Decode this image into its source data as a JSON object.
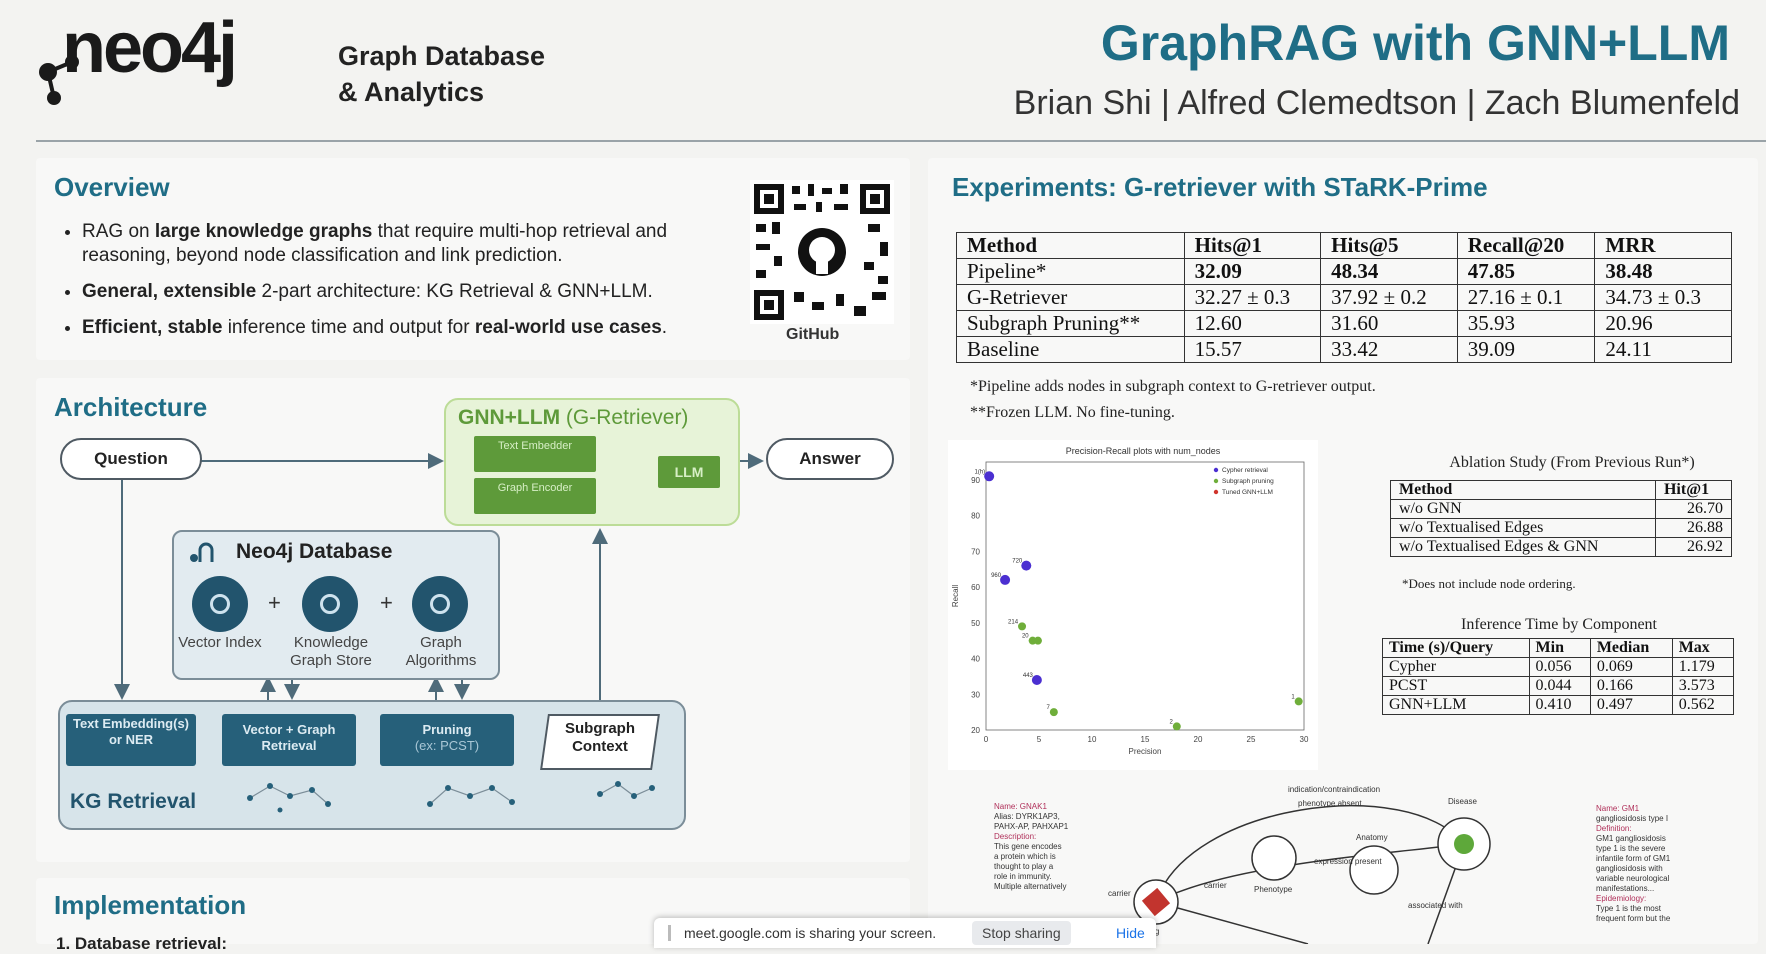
{
  "header": {
    "logo_text": "neo4j",
    "logo_subtitle_line1": "Graph Database",
    "logo_subtitle_line2": "& Analytics",
    "title": "GraphRAG with GNN+LLM",
    "authors": "Brian Shi | Alfred Clemedtson | Zach Blumenfeld"
  },
  "overview": {
    "title": "Overview",
    "bullets": [
      {
        "b1": "RAG on ",
        "b2": "large knowledge graphs",
        "b3": " that require multi-hop retrieval and reasoning, beyond node classification and link prediction."
      },
      {
        "b1": "",
        "b2": "General, extensible",
        "b3": " 2-part architecture: KG Retrieval & GNN+LLM."
      },
      {
        "b1": "",
        "b2": "Efficient, stable",
        "b3": " inference time and output for ",
        "b4": "real-world use cases",
        "b5": "."
      }
    ],
    "qr_label": "GitHub"
  },
  "architecture": {
    "title": "Architecture",
    "gnn_title": "GNN+LLM",
    "gnn_subtitle": "(G-Retriever)",
    "text_embedder": "Text Embedder",
    "graph_encoder": "Graph Encoder",
    "llm": "LLM",
    "question": "Question",
    "answer": "Answer",
    "db_title": "Neo4j Database",
    "vector_index": "Vector Index",
    "kg_store": "Knowledge Graph Store",
    "graph_algorithms": "Graph Algorithms",
    "plus": "+",
    "text_embedding": "Text Embedding(s) or NER",
    "vector_graph_retrieval": "Vector + Graph Retrieval",
    "pruning": "Pruning",
    "pruning_sub": "(ex: PCST)",
    "subgraph_context": "Subgraph Context",
    "kg_retrieval": "KG Retrieval"
  },
  "implementation": {
    "title": "Implementation",
    "item1": "1.  Database retrieval:"
  },
  "experiments": {
    "title": "Experiments: G-retriever with STaRK-Prime",
    "headers": [
      "Method",
      "Hits@1",
      "Hits@5",
      "Recall@20",
      "MRR"
    ],
    "rows": [
      [
        "Pipeline*",
        "32.09",
        "48.34",
        "47.85",
        "38.48"
      ],
      [
        "G-Retriever",
        "32.27 ± 0.3",
        "37.92 ± 0.2",
        "27.16 ± 0.1",
        "34.73 ± 0.3"
      ],
      [
        "Subgraph Pruning**",
        "12.60",
        "31.60",
        "35.93",
        "20.96"
      ],
      [
        "Baseline",
        "15.57",
        "33.42",
        "39.09",
        "24.11"
      ]
    ],
    "note1": "*Pipeline adds nodes in subgraph context to G-retriever output.",
    "note2": "**Frozen LLM. No fine-tuning."
  },
  "ablation": {
    "title": "Ablation Study (From Previous Run*)",
    "headers": [
      "Method",
      "Hit@1"
    ],
    "rows": [
      [
        "w/o GNN",
        "26.70"
      ],
      [
        "w/o Textualised Edges",
        "26.88"
      ],
      [
        "w/o Textualised Edges & GNN",
        "26.92"
      ]
    ],
    "note": "*Does not include node ordering."
  },
  "inference": {
    "title": "Inference Time by Component",
    "headers": [
      "Time (s)/Query",
      "Min",
      "Median",
      "Max"
    ],
    "rows": [
      [
        "Cypher",
        "0.056",
        "0.069",
        "1.179"
      ],
      [
        "PCST",
        "0.044",
        "0.166",
        "3.573"
      ],
      [
        "GNN+LLM",
        "0.410",
        "0.497",
        "0.562"
      ]
    ]
  },
  "chart_data": {
    "type": "scatter",
    "title": "Precision-Recall plots with num_nodes",
    "xlabel": "Precision",
    "ylabel": "Recall",
    "xlim": [
      0,
      30
    ],
    "ylim": [
      20,
      95
    ],
    "xticks": [
      "0",
      "5",
      "10",
      "15",
      "20",
      "25",
      "30"
    ],
    "yticks": [
      "20",
      "30",
      "40",
      "50",
      "60",
      "70",
      "80",
      "90"
    ],
    "legend": [
      "Cypher retrieval",
      "Subgraph pruning",
      "Tuned GNN+LLM"
    ],
    "colors": [
      "#4b2fd1",
      "#6fae3a",
      "#d0342c"
    ],
    "series": [
      {
        "name": "Cypher retrieval",
        "points": [
          {
            "x": 0.3,
            "y": 91,
            "label": "1(h)"
          },
          {
            "x": 3.8,
            "y": 66,
            "label": "720"
          },
          {
            "x": 1.8,
            "y": 62,
            "label": "960"
          },
          {
            "x": 4.8,
            "y": 34,
            "label": "443"
          }
        ]
      },
      {
        "name": "Subgraph pruning",
        "points": [
          {
            "x": 3.4,
            "y": 49,
            "label": "214"
          },
          {
            "x": 4.4,
            "y": 45,
            "label": "20"
          },
          {
            "x": 4.9,
            "y": 45,
            "label": ""
          },
          {
            "x": 6.4,
            "y": 25,
            "label": "7"
          },
          {
            "x": 18.0,
            "y": 21,
            "label": "2"
          },
          {
            "x": 29.5,
            "y": 28,
            "label": "1"
          }
        ]
      }
    ]
  },
  "kg_snippet": {
    "left_lines": [
      "Name: GNAK1",
      "Alias: DYRK1AP3,",
      "PAHX-AP, PAHXAP1",
      "Description:",
      "This gene encodes",
      "a protein which is",
      "thought to play a",
      "role in immunity.",
      "Multiple alternatively"
    ],
    "right_lines": [
      "Name: GM1",
      "gangliosidosis type I",
      "Definition:",
      "GM1 gangliosidosis",
      "type 1 is the severe",
      "infantile form of GM1",
      "gangliosidosis with",
      "variable neurological",
      "manifestations...",
      "Epidemiology:",
      "Type 1 is the most",
      "frequent form but the"
    ],
    "labels": [
      "indication/contraindication",
      "phenotype absent",
      "Disease",
      "carrier",
      "Phenotype",
      "expression present",
      "Anatomy",
      "carrier",
      "associated with",
      "Drug"
    ]
  },
  "share_bar": {
    "message": "meet.google.com is sharing your screen.",
    "stop": "Stop sharing",
    "hide": "Hide"
  }
}
